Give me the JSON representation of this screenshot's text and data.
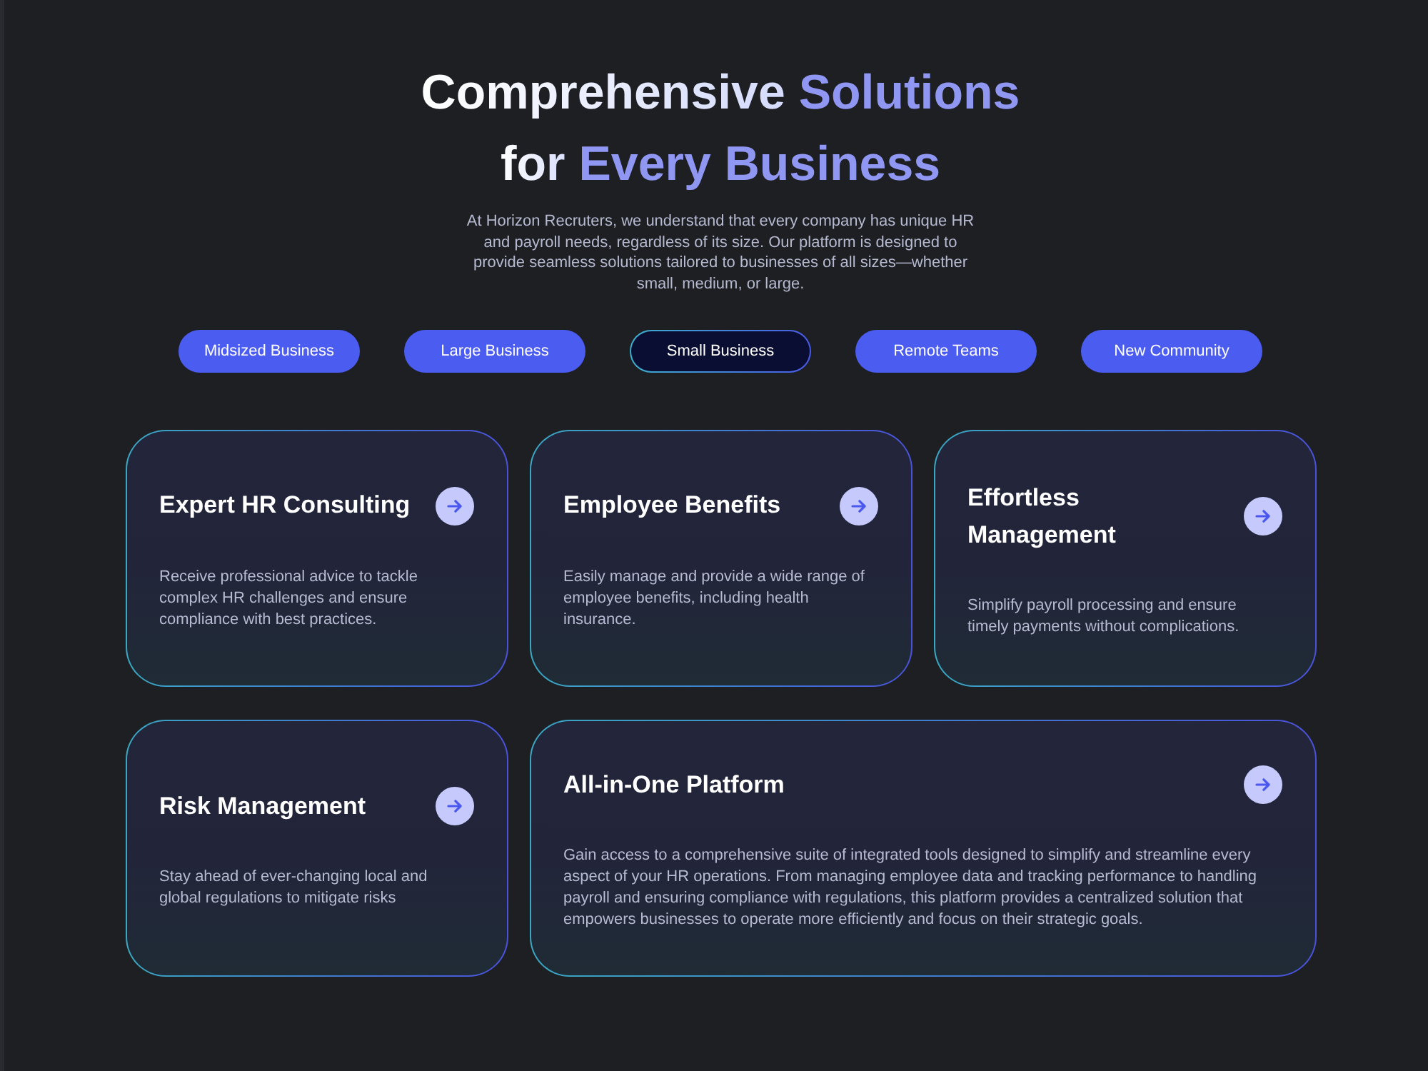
{
  "heading": {
    "lines": [
      [
        {
          "text": "Comprehensive ",
          "accent": false
        },
        {
          "text": "Solutions",
          "accent": true
        }
      ],
      [
        {
          "text": "for ",
          "accent": false
        },
        {
          "text": "Every Business",
          "accent": true
        }
      ]
    ]
  },
  "intro": "At Horizon Recruters, we understand that every company has unique HR and payroll needs, regardless of its size. Our platform is designed to provide seamless solutions tailored to businesses of all sizes—whether small, medium, or large.",
  "tabs": [
    {
      "label": "Midsized Business",
      "selected": false
    },
    {
      "label": "Large Business",
      "selected": false
    },
    {
      "label": "Small Business",
      "selected": true
    },
    {
      "label": "Remote Teams",
      "selected": false
    },
    {
      "label": "New Community",
      "selected": false
    }
  ],
  "cards": [
    {
      "kind": "standard",
      "title": "Expert HR Consulting",
      "description": "Receive professional advice to tackle complex HR challenges and ensure compliance with best practices."
    },
    {
      "kind": "standard",
      "title": "Employee Benefits",
      "description": "Easily manage and provide a wide range of employee benefits, including health insurance."
    },
    {
      "kind": "standard",
      "title": "Effortless Management",
      "description": "Simplify payroll processing and ensure timely payments without complications."
    },
    {
      "kind": "standard",
      "title": "Risk Management",
      "description": "Stay ahead of ever-changing local and global regulations to mitigate risks"
    },
    {
      "kind": "wide",
      "title": "All-in-One Platform",
      "description": "Gain access to a comprehensive suite of integrated tools designed to simplify and streamline every aspect of your HR operations. From managing employee data and tracking performance to handling payroll and ensuring compliance with regulations, this platform provides a centralized solution that empowers businesses to operate more efficiently and focus on their strategic goals."
    }
  ]
}
